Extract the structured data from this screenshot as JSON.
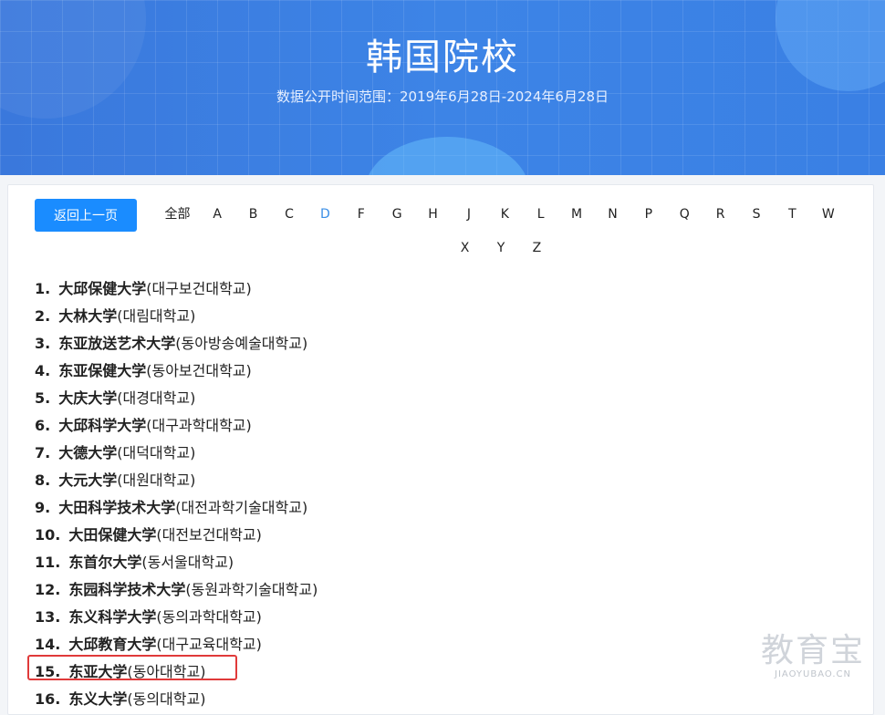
{
  "header": {
    "title": "韩国院校",
    "subtitle": "数据公开时间范围：2019年6月28日-2024年6月28日"
  },
  "nav": {
    "back_label": "返回上一页",
    "all_label": "全部",
    "letters": [
      "A",
      "B",
      "C",
      "D",
      "F",
      "G",
      "H",
      "J",
      "K",
      "L",
      "M",
      "N",
      "P",
      "Q",
      "R",
      "S",
      "T",
      "W",
      "X",
      "Y",
      "Z"
    ],
    "active_letter": "D"
  },
  "schools": [
    {
      "num": "1.",
      "cn": "大邱保健大学",
      "kr": "(대구보건대학교)"
    },
    {
      "num": "2.",
      "cn": "大林大学",
      "kr": "(대림대학교)"
    },
    {
      "num": "3.",
      "cn": "东亚放送艺术大学",
      "kr": "(동아방송예술대학교)"
    },
    {
      "num": "4.",
      "cn": "东亚保健大学",
      "kr": "(동아보건대학교)"
    },
    {
      "num": "5.",
      "cn": "大庆大学",
      "kr": "(대경대학교)"
    },
    {
      "num": "6.",
      "cn": "大邱科学大学",
      "kr": "(대구과학대학교)"
    },
    {
      "num": "7.",
      "cn": "大德大学",
      "kr": "(대덕대학교)"
    },
    {
      "num": "8.",
      "cn": "大元大学",
      "kr": "(대원대학교)"
    },
    {
      "num": "9.",
      "cn": "大田科学技术大学",
      "kr": "(대전과학기술대학교)"
    },
    {
      "num": "10.",
      "cn": "大田保健大学",
      "kr": "(대전보건대학교)"
    },
    {
      "num": "11.",
      "cn": "东首尔大学",
      "kr": "(동서울대학교)"
    },
    {
      "num": "12.",
      "cn": "东园科学技术大学",
      "kr": "(동원과학기술대학교)"
    },
    {
      "num": "13.",
      "cn": "东义科学大学",
      "kr": "(동의과학대학교)"
    },
    {
      "num": "14.",
      "cn": "大邱教育大学",
      "kr": "(대구교육대학교)"
    },
    {
      "num": "15.",
      "cn": "东亚大学",
      "kr": "(동아대학교)"
    },
    {
      "num": "16.",
      "cn": "东义大学",
      "kr": "(동의대학교)"
    }
  ],
  "watermark": {
    "brand": "教育宝",
    "domain": "JIAOYUBAO.CN"
  },
  "colors": {
    "accent": "#1a8cff",
    "active_letter": "#3a8ee6",
    "highlight_border": "#e03a3a"
  }
}
